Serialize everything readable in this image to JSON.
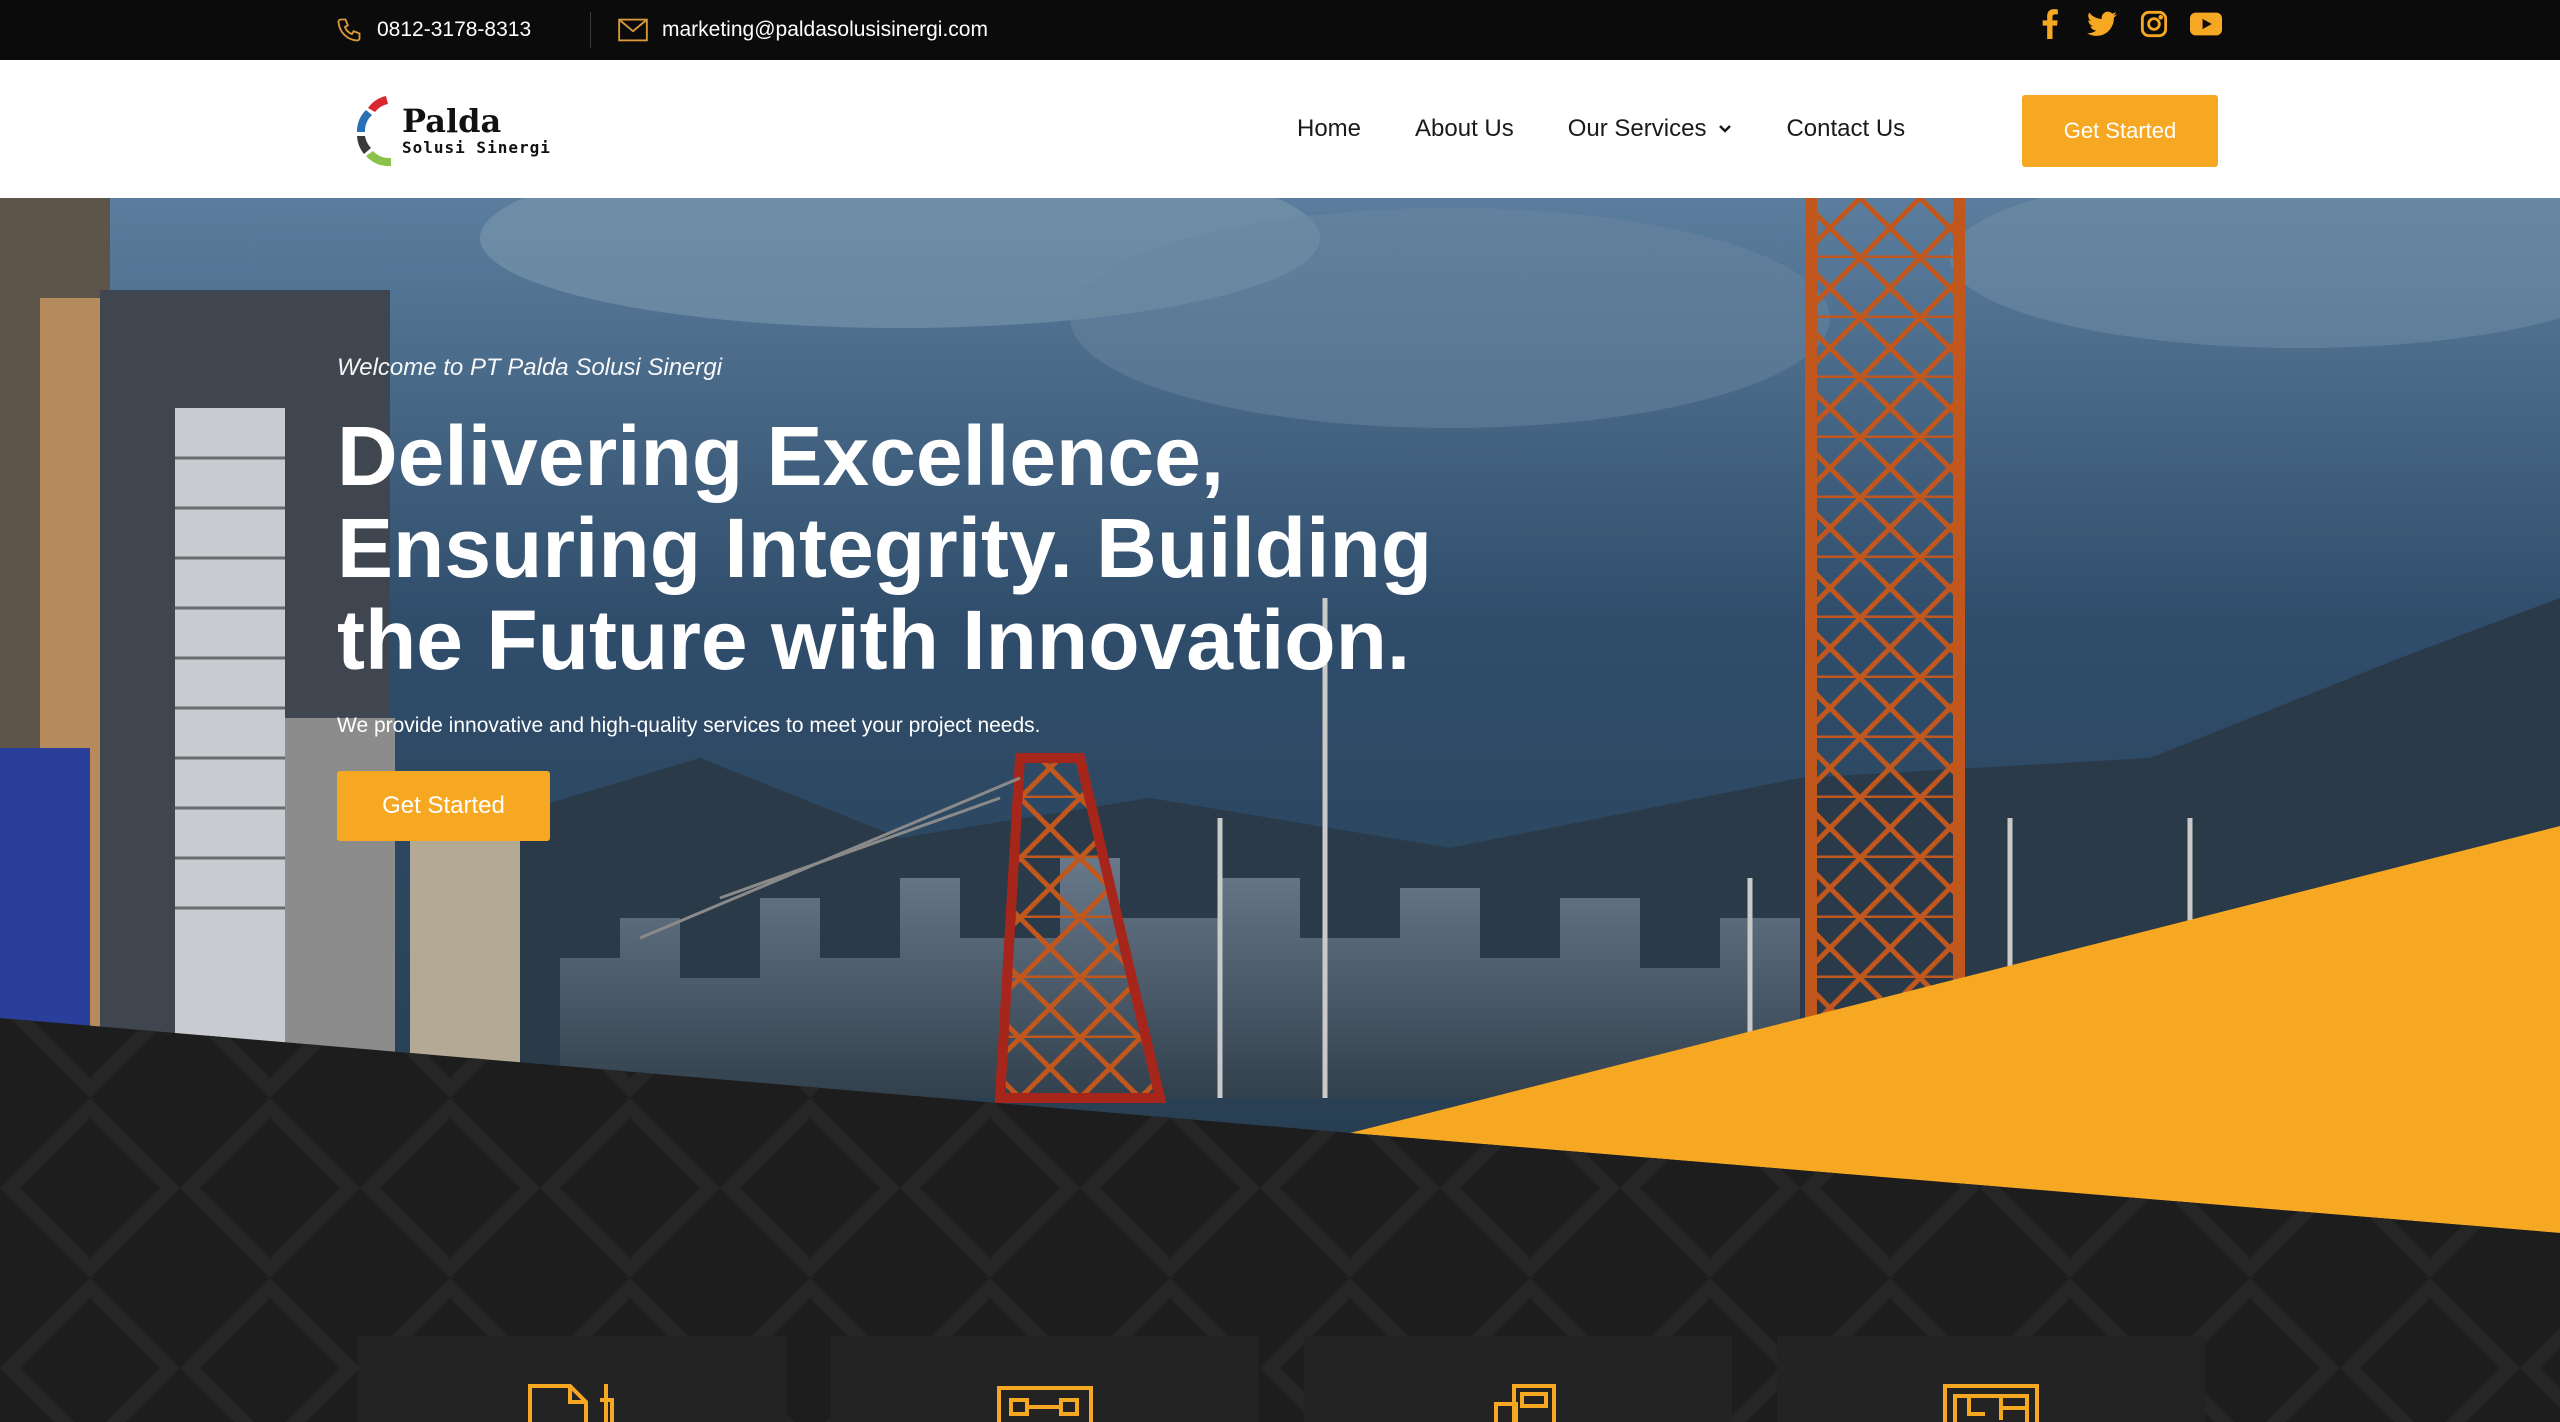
{
  "topbar": {
    "phone": "0812-3178-8313",
    "email": "marketing@paldasolusisinergi.com",
    "socials": [
      "facebook-icon",
      "twitter-icon",
      "instagram-icon",
      "youtube-icon"
    ]
  },
  "header": {
    "logo_main": "Palda",
    "logo_sub": "Solusi Sinergi",
    "nav": [
      {
        "label": "Home"
      },
      {
        "label": "About Us"
      },
      {
        "label": "Our Services"
      },
      {
        "label": "Contact Us"
      }
    ],
    "cta_label": "Get Started"
  },
  "hero": {
    "welcome": "Welcome to PT Palda Solusi Sinergi",
    "title": "Delivering Excellence, Ensuring Integrity. Building the Future with Innovation.",
    "description": "We provide innovative and high-quality services to meet your project needs.",
    "cta_label": "Get Started"
  },
  "cards": [
    {
      "icon": "document-pen-icon"
    },
    {
      "icon": "blueprint-icon"
    },
    {
      "icon": "buildings-icon"
    },
    {
      "icon": "floor-plan-icon"
    }
  ],
  "colors": {
    "accent": "#f7a823",
    "topbar": "#0b0b0b",
    "dark": "#1d1d1d"
  }
}
